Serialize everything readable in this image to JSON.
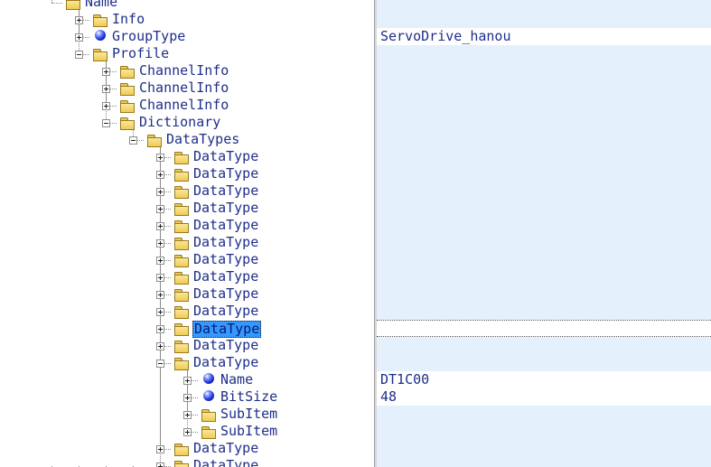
{
  "tree": {
    "rows": [
      {
        "label": "Name",
        "icon": "folder-icon",
        "expander": "none"
      },
      {
        "label": "Info",
        "icon": "folder-icon",
        "expander": "plus"
      },
      {
        "label": "GroupType",
        "icon": "blue-ball-icon",
        "expander": "plus"
      },
      {
        "label": "Profile",
        "icon": "open-folder-icon",
        "expander": "minus"
      },
      {
        "label": "ChannelInfo",
        "icon": "folder-icon",
        "expander": "plus"
      },
      {
        "label": "ChannelInfo",
        "icon": "folder-icon",
        "expander": "plus"
      },
      {
        "label": "ChannelInfo",
        "icon": "folder-icon",
        "expander": "plus"
      },
      {
        "label": "Dictionary",
        "icon": "open-folder-icon",
        "expander": "minus"
      },
      {
        "label": "DataTypes",
        "icon": "open-folder-icon",
        "expander": "minus"
      },
      {
        "label": "DataType",
        "icon": "folder-icon",
        "expander": "plus"
      },
      {
        "label": "DataType",
        "icon": "folder-icon",
        "expander": "plus"
      },
      {
        "label": "DataType",
        "icon": "folder-icon",
        "expander": "plus"
      },
      {
        "label": "DataType",
        "icon": "folder-icon",
        "expander": "plus"
      },
      {
        "label": "DataType",
        "icon": "folder-icon",
        "expander": "plus"
      },
      {
        "label": "DataType",
        "icon": "folder-icon",
        "expander": "plus"
      },
      {
        "label": "DataType",
        "icon": "folder-icon",
        "expander": "plus"
      },
      {
        "label": "DataType",
        "icon": "folder-icon",
        "expander": "plus"
      },
      {
        "label": "DataType",
        "icon": "folder-icon",
        "expander": "plus"
      },
      {
        "label": "DataType",
        "icon": "folder-icon",
        "expander": "plus"
      },
      {
        "label": "DataType",
        "icon": "folder-icon",
        "expander": "plus",
        "selected": true
      },
      {
        "label": "DataType",
        "icon": "folder-icon",
        "expander": "plus"
      },
      {
        "label": "DataType",
        "icon": "open-folder-icon",
        "expander": "minus"
      },
      {
        "label": "Name",
        "icon": "blue-ball-icon",
        "expander": "plus"
      },
      {
        "label": "BitSize",
        "icon": "blue-ball-icon",
        "expander": "plus"
      },
      {
        "label": "SubItem",
        "icon": "folder-icon",
        "expander": "plus"
      },
      {
        "label": "SubItem",
        "icon": "folder-icon",
        "expander": "plus"
      },
      {
        "label": "DataType",
        "icon": "folder-icon",
        "expander": "plus"
      },
      {
        "label": "DataType",
        "icon": "folder-icon",
        "expander": "plus"
      }
    ]
  },
  "values": {
    "rows": [
      {
        "row": 2,
        "text": "ServoDrive_hanou"
      },
      {
        "row": 19,
        "text": ""
      },
      {
        "row": 22,
        "text": "DT1C00"
      },
      {
        "row": 23,
        "text": "48"
      }
    ]
  },
  "colors": {
    "text": "#1e2f8a",
    "selection": "#3399ff",
    "values_background": "#e4f1fd",
    "folder": "#efcb55",
    "blue_ball": "#1f2fd8"
  }
}
